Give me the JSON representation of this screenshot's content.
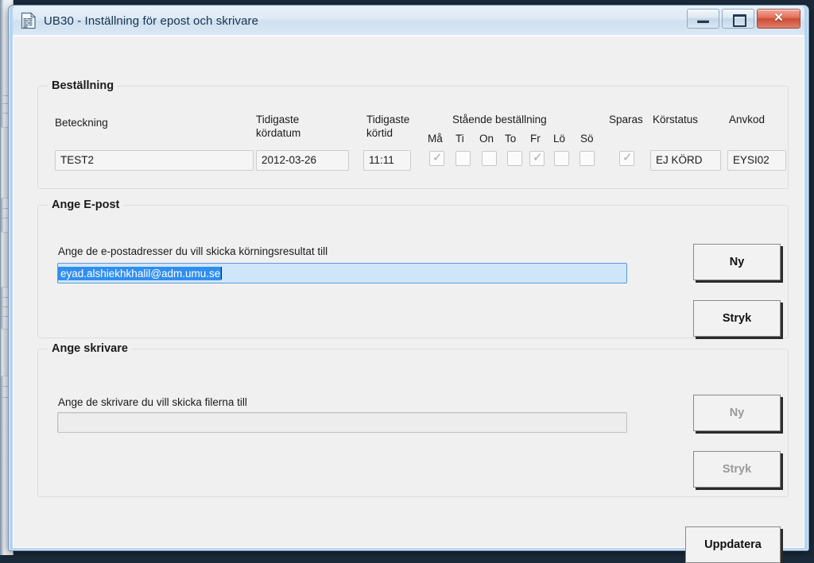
{
  "window": {
    "title": "UB30 - Inställning för epost och skrivare",
    "icon": "document-app-icon",
    "controls": {
      "minimize": "minimize-icon",
      "maximize": "maximize-icon",
      "close": "✕"
    },
    "accent_color": "#b6d3ee",
    "client_color": "#f0f0f0"
  },
  "order_group": {
    "legend": "Beställning",
    "labels": {
      "beteckning": "Beteckning",
      "kordatum_line1": "Tidigaste",
      "kordatum_line2": "kördatum",
      "kortid_line1": "Tidigaste",
      "kortid_line2": "körtid",
      "standing_order": "Stående beställning",
      "sparas": "Sparas",
      "korstatus": "Körstatus",
      "anvkod": "Anvkod"
    },
    "values": {
      "beteckning": "TEST2",
      "kordatum": "2012-03-26",
      "kortid": "11:11",
      "korstatus": "EJ KÖRD",
      "anvkod": "EYSI02"
    },
    "weekdays": [
      {
        "label": "Må",
        "checked": true
      },
      {
        "label": "Ti",
        "checked": false
      },
      {
        "label": "On",
        "checked": false
      },
      {
        "label": "To",
        "checked": false
      },
      {
        "label": "Fr",
        "checked": true
      },
      {
        "label": "Lö",
        "checked": false
      },
      {
        "label": "Sö",
        "checked": false
      }
    ],
    "sparas_checked": true,
    "check_glyph": "✓"
  },
  "email_group": {
    "legend": "Ange E-post",
    "instruction": "Ange de e-postadresser du vill skicka körningsresultat till",
    "value": "eyad.alshiekhkhalil@adm.umu.se",
    "selected": true,
    "selection_color": "#2f8eef",
    "field_color": "#cfe6fa",
    "new_button": "Ny",
    "delete_button": "Stryk"
  },
  "printer_group": {
    "legend": "Ange skrivare",
    "instruction": "Ange de skrivare du vill skicka filerna till",
    "value": "",
    "new_button": "Ny",
    "delete_button": "Stryk",
    "disabled": true
  },
  "footer": {
    "update_button": "Uppdatera"
  }
}
